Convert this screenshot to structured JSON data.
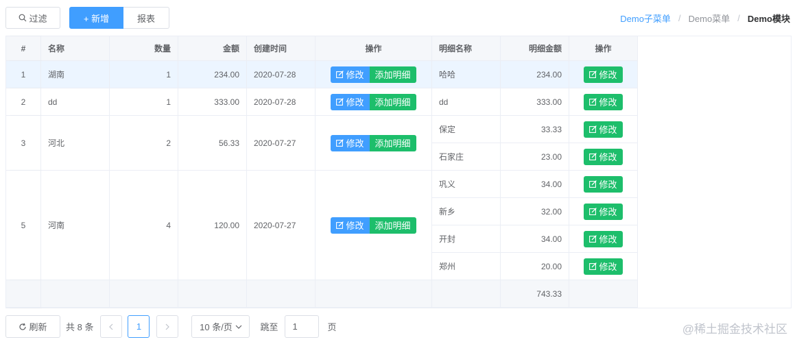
{
  "toolbar": {
    "filter_label": "过滤",
    "add_label": "+ 新增",
    "report_label": "报表"
  },
  "breadcrumb": {
    "items": [
      "Demo子菜单",
      "Demo菜单",
      "Demo模块"
    ]
  },
  "table": {
    "headers": {
      "index": "#",
      "name": "名称",
      "qty": "数量",
      "amount": "金额",
      "created": "创建时间",
      "ops": "操作",
      "detail_name": "明细名称",
      "detail_amount": "明细金额",
      "detail_ops": "操作"
    },
    "edit_label": "修改",
    "add_detail_label": "添加明细",
    "rows": [
      {
        "index": "1",
        "name": "湖南",
        "qty": "1",
        "amount": "234.00",
        "created": "2020-07-28",
        "details": [
          {
            "name": "哈哈",
            "amount": "234.00"
          }
        ]
      },
      {
        "index": "2",
        "name": "dd",
        "qty": "1",
        "amount": "333.00",
        "created": "2020-07-28",
        "details": [
          {
            "name": "dd",
            "amount": "333.00"
          }
        ]
      },
      {
        "index": "3",
        "name": "河北",
        "qty": "2",
        "amount": "56.33",
        "created": "2020-07-27",
        "details": [
          {
            "name": "保定",
            "amount": "33.33"
          },
          {
            "name": "石家庄",
            "amount": "23.00"
          }
        ]
      },
      {
        "index": "5",
        "name": "河南",
        "qty": "4",
        "amount": "120.00",
        "created": "2020-07-27",
        "details": [
          {
            "name": "巩义",
            "amount": "34.00"
          },
          {
            "name": "新乡",
            "amount": "32.00"
          },
          {
            "name": "开封",
            "amount": "34.00"
          },
          {
            "name": "郑州",
            "amount": "20.00"
          }
        ]
      }
    ],
    "footer_total": "743.33"
  },
  "pager": {
    "refresh_label": "刷新",
    "total_text": "共 8 条",
    "current_page": "1",
    "page_size": "10 条/页",
    "jump_label": "跳至",
    "jump_value": "1",
    "page_unit": "页"
  },
  "watermark": "@稀土掘金技术社区"
}
